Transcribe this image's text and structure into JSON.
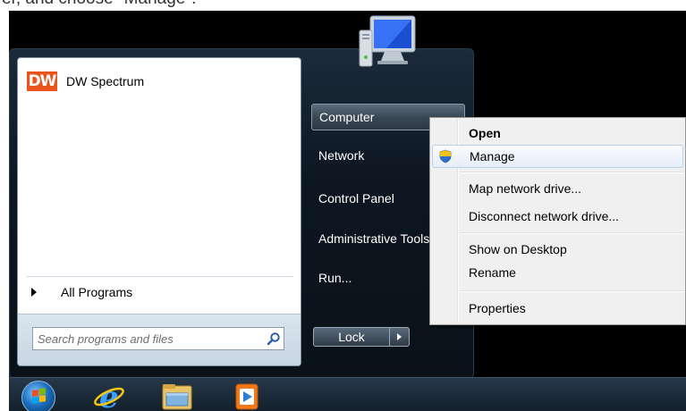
{
  "caption": "er, and choose \"Manage\".",
  "start_menu": {
    "pinned": [
      {
        "label": "DW Spectrum",
        "logo_text": "DW"
      }
    ],
    "all_programs_label": "All Programs",
    "search_placeholder": "Search programs and files",
    "right_items": [
      {
        "label": "Computer"
      },
      {
        "label": "Network"
      },
      {
        "label": "Control Panel"
      },
      {
        "label": "Administrative Tools"
      },
      {
        "label": "Run..."
      }
    ],
    "lock_label": "Lock"
  },
  "context_menu": {
    "items": [
      {
        "label": "Open",
        "bold": true
      },
      {
        "label": "Manage",
        "icon": "uac-shield-icon",
        "hovered": true
      },
      {
        "label": "Map network drive..."
      },
      {
        "label": "Disconnect network drive..."
      },
      {
        "label": "Show on Desktop"
      },
      {
        "label": "Rename"
      },
      {
        "label": "Properties"
      }
    ]
  },
  "taskbar": {
    "icons": [
      "start-orb-icon",
      "internet-explorer-icon",
      "file-explorer-icon",
      "media-player-icon"
    ]
  },
  "colors": {
    "dw_logo": "#e8541c",
    "menu_hover": "#e5eef8",
    "screen_bg": "#000000"
  }
}
